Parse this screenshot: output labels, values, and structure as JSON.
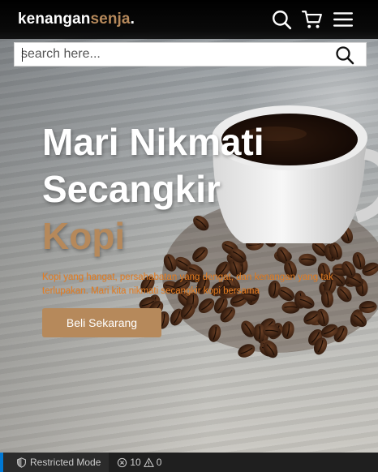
{
  "navbar": {
    "logo_main": "kenangan",
    "logo_accent": "senja",
    "logo_dot": ".",
    "icons": [
      "search-icon",
      "cart-icon",
      "menu-icon"
    ]
  },
  "search": {
    "placeholder": "search here...",
    "button_icon": "search-icon"
  },
  "hero": {
    "title_line1": "Mari Nikmati",
    "title_line2": "Secangkir",
    "title_accent": "Kopi",
    "description": "Kopi yang hangat, persahabatan yang dengat, dan kenangan yang tak terlupakan. Mari kita nikmati secangkir kopi bersama",
    "cta_label": "Beli Sekarang"
  },
  "statusbar": {
    "restricted_label": "Restricted Mode",
    "errors": "10",
    "warnings": "0"
  },
  "colors": {
    "accent": "#b6895b",
    "description_text": "#e67e22",
    "navbar_bg": "#000000",
    "statusbar_bg": "#1f1f1f",
    "statusbar_accent": "#0078d4"
  }
}
